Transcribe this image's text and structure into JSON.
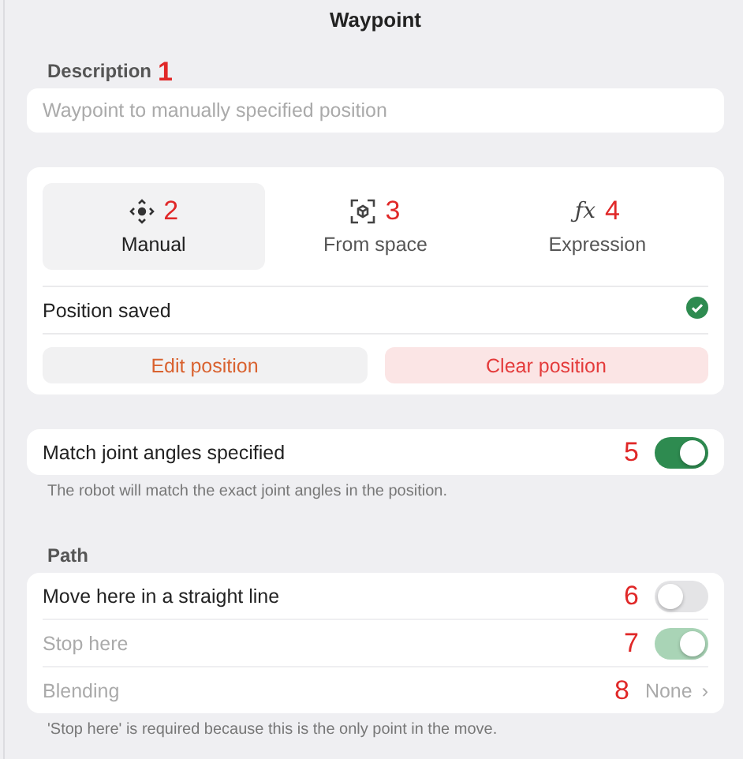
{
  "title": "Waypoint",
  "description": {
    "label": "Description",
    "annotation": "1",
    "placeholder": "Waypoint to manually specified position"
  },
  "modes": [
    {
      "kind": "manual",
      "label": "Manual",
      "annotation": "2",
      "selected": true
    },
    {
      "kind": "space",
      "label": "From space",
      "annotation": "3",
      "selected": false
    },
    {
      "kind": "expression",
      "label": "Expression",
      "icon": "ƒx",
      "annotation": "4",
      "selected": false
    }
  ],
  "position_status": {
    "label": "Position saved",
    "saved": true
  },
  "position_buttons": [
    {
      "kind": "neutral",
      "label": "Edit position"
    },
    {
      "kind": "danger",
      "label": "Clear position"
    }
  ],
  "joint_angles": {
    "label": "Match joint angles specified",
    "annotation": "5",
    "on": true,
    "hint": "The robot will match the exact joint angles in the position."
  },
  "path": {
    "heading": "Path",
    "rows": [
      {
        "kind": "toggle",
        "label": "Move here in a straight line",
        "annotation": "6",
        "on": false,
        "disabled": false
      },
      {
        "kind": "toggle",
        "label": "Stop here",
        "annotation": "7",
        "on": true,
        "disabled": true
      },
      {
        "kind": "value",
        "label": "Blending",
        "annotation": "8",
        "value": "None",
        "chevron": "›",
        "disabled": true
      }
    ],
    "note": "'Stop here' is required because this is the only point in the move."
  }
}
